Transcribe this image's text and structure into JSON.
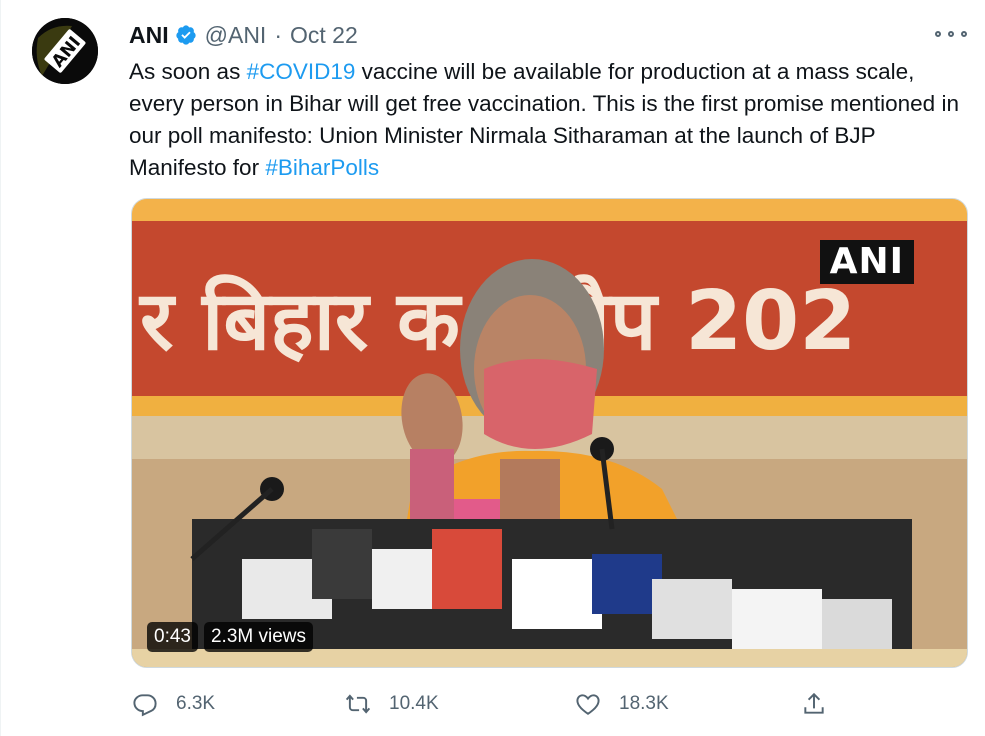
{
  "author": {
    "name": "ANI",
    "handle": "@ANI",
    "separator": "·",
    "date": "Oct 22",
    "avatar_text": "ANI"
  },
  "tweet": {
    "text_part1": "As soon as ",
    "hashtag1": "#COVID19",
    "text_part2": " vaccine will be available for production at a mass scale, every person in Bihar will get free vaccination. This is the first promise mentioned in our poll manifesto: Union Minister Nirmala Sitharaman at the launch of BJP Manifesto for ",
    "hashtag2": "#BiharPolls"
  },
  "media": {
    "watermark": "ANI",
    "banner_text": "र बिहार क     ड मैप 202",
    "duration": "0:43",
    "views": "2.3M views"
  },
  "actions": {
    "replies": "6.3K",
    "retweets": "10.4K",
    "likes": "18.3K"
  },
  "colors": {
    "accent": "#1d9bf0",
    "secondary_text": "#536471",
    "banner_orange": "#f0a030",
    "banner_red": "#c8452a"
  },
  "icons": [
    "verified-badge-icon",
    "more-options-icon",
    "reply-icon",
    "retweet-icon",
    "like-icon",
    "share-icon"
  ]
}
